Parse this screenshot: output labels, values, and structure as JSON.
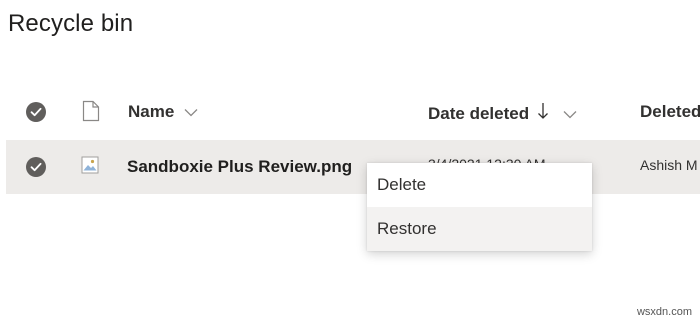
{
  "page": {
    "title": "Recycle bin"
  },
  "header": {
    "name_label": "Name",
    "date_label": "Date deleted",
    "sort_indicator": "↓",
    "deleted_by_label": "Deleted"
  },
  "rows": [
    {
      "name": "Sandboxie Plus Review.png",
      "date_deleted": "3/4/2021 12:30 AM",
      "deleted_by": "Ashish M",
      "selected": true
    }
  ],
  "context_menu": {
    "items": [
      {
        "label": "Delete"
      },
      {
        "label": "Restore"
      }
    ],
    "hovered": "Restore"
  },
  "watermark": "wsxdn.com",
  "colors": {
    "selected_row": "#edebe9",
    "check_circle": "#605e5c",
    "menu_hover": "#f3f2f1"
  },
  "icons": {
    "select_all": "check-circle-icon",
    "file_type_header": "document-icon",
    "row_check": "check-circle-icon",
    "row_file": "image-file-icon"
  }
}
